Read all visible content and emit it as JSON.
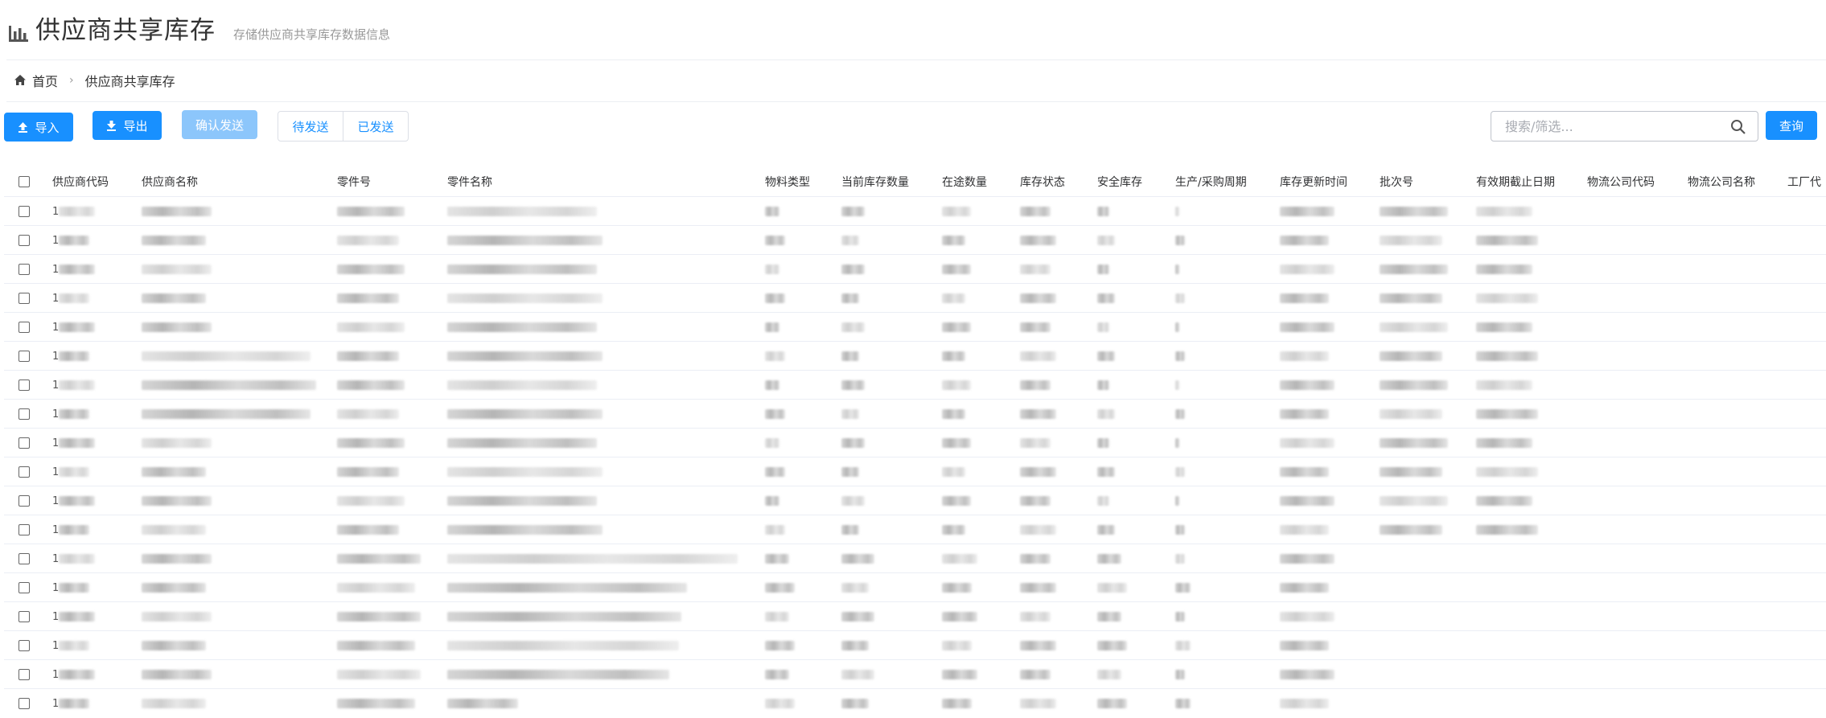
{
  "header": {
    "title": "供应商共享库存",
    "subtitle": "存储供应商共享库存数据信息"
  },
  "breadcrumb": {
    "home": "首页",
    "current": "供应商共享库存"
  },
  "toolbar": {
    "import_label": "导入",
    "export_label": "导出",
    "confirm_send_label": "确认发送",
    "tab_pending": "待发送",
    "tab_sent": "已发送",
    "search_placeholder": "搜索/筛选...",
    "query_label": "查询"
  },
  "colors": {
    "primary": "#1890ff",
    "disabled": "#8cc6fb"
  },
  "icons": [
    "bar-chart-icon",
    "home-icon",
    "chevron-right-icon",
    "upload-icon",
    "download-icon",
    "search-icon",
    "checkbox-icon"
  ],
  "table": {
    "columns": [
      "供应商代码",
      "供应商名称",
      "零件号",
      "零件名称",
      "物料类型",
      "当前库存数量",
      "在途数量",
      "库存状态",
      "安全库存",
      "生产/采购周期",
      "库存更新时间",
      "批次号",
      "有效期截止日期",
      "物流公司代码",
      "物流公司名称",
      "工厂代"
    ],
    "row_prefix": "1",
    "row_count": 18
  }
}
